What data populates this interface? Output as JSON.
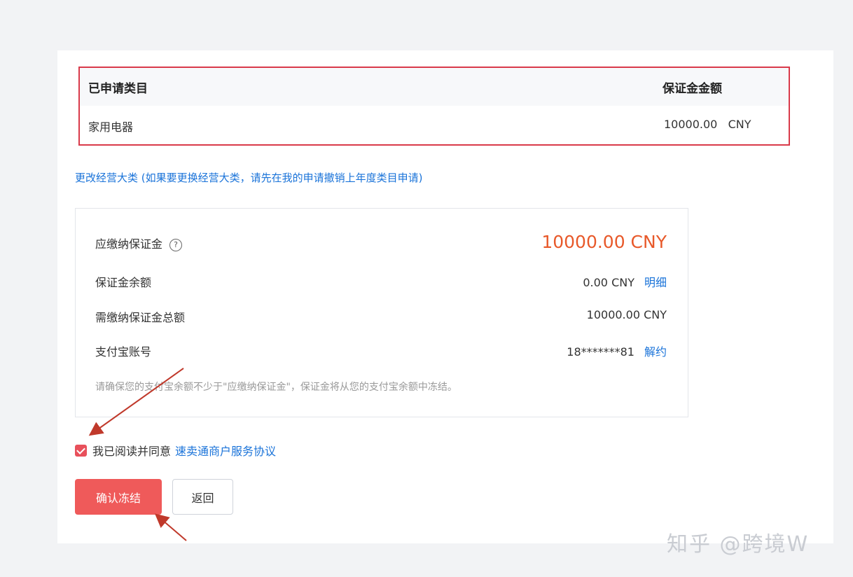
{
  "table": {
    "header_category": "已申请类目",
    "header_amount": "保证金金额",
    "row_category": "家用电器",
    "row_amount": "10000.00   CNY"
  },
  "change_link": "更改经营大类 (如果要更换经营大类，请先在我的申请撤销上年度类目申请)",
  "info": {
    "payable_label": "应缴纳保证金",
    "payable_value": "10000.00 CNY",
    "balance_label": "保证金余额",
    "balance_value": "0.00 CNY",
    "balance_link": "明细",
    "total_label": "需缴纳保证金总额",
    "total_value": "10000.00 CNY",
    "alipay_label": "支付宝账号",
    "alipay_value": "18*******81",
    "alipay_link": "解约",
    "note": "请确保您的支付宝余额不少于\"应缴纳保证金\"，保证金将从您的支付宝余额中冻结。"
  },
  "agree": {
    "text": "我已阅读并同意",
    "link": "速卖通商户服务协议"
  },
  "buttons": {
    "confirm": "确认冻结",
    "back": "返回"
  },
  "watermark": "知乎 @跨境W",
  "colors": {
    "accent_red": "#ef5a5a",
    "highlight_border": "#d93a4a",
    "amount_orange": "#e8592a",
    "link_blue": "#1a73d9"
  }
}
